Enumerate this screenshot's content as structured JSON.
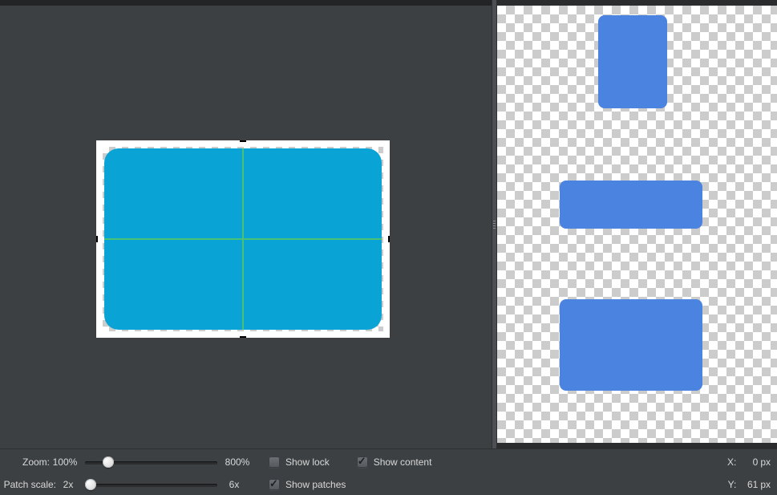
{
  "controls": {
    "zoom": {
      "label": "Zoom:",
      "min_label": "100%",
      "max_label": "800%"
    },
    "patch_scale": {
      "label": "Patch scale:",
      "min_label": "2x",
      "max_label": "6x"
    },
    "show_lock": {
      "label": "Show lock",
      "checked": false
    },
    "show_content": {
      "label": "Show content",
      "checked": true
    },
    "show_patches": {
      "label": "Show patches",
      "checked": true
    }
  },
  "cursor": {
    "x_label": "X:",
    "x_value": "0",
    "y_label": "Y:",
    "y_value": "61",
    "unit": "px"
  },
  "colors": {
    "editor_shape": "#0aa3d6",
    "preview_shape": "#4a83e0",
    "guide": "#49c176"
  }
}
